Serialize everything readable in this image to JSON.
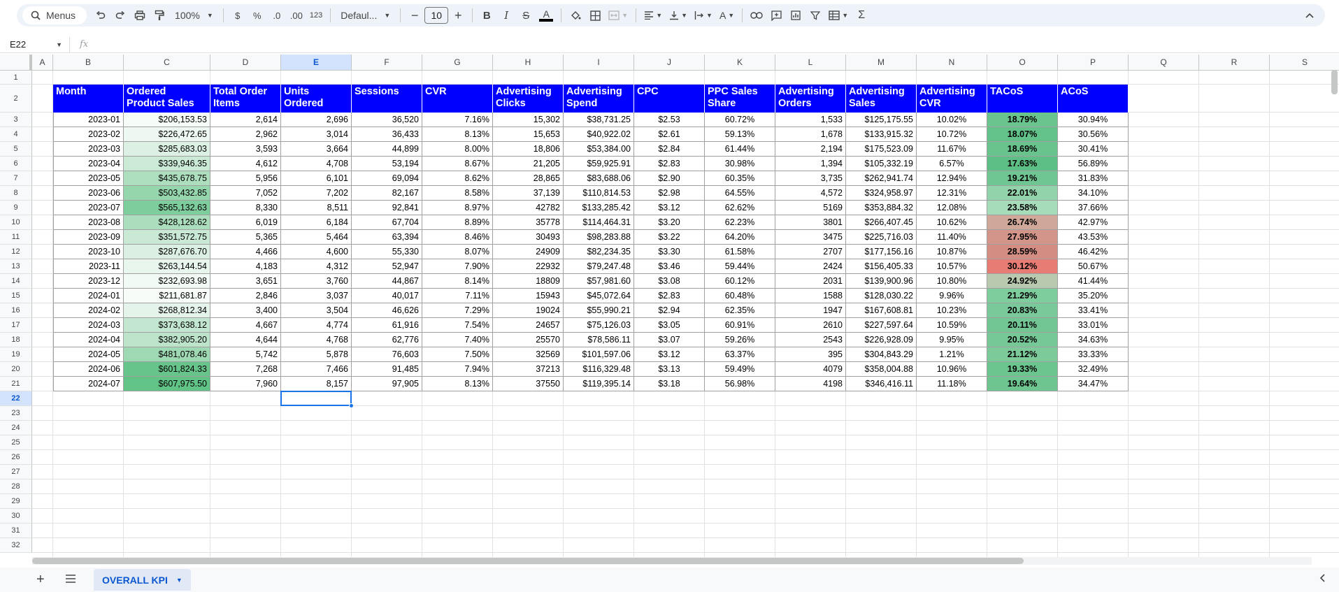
{
  "toolbar": {
    "menus_label": "Menus",
    "zoom": "100%",
    "currency": "$",
    "percent": "%",
    "dec_decrease": ".0",
    "dec_increase": ".00",
    "number_format": "123",
    "font": "Defaul...",
    "font_size": "10"
  },
  "formula_bar": {
    "cell_ref": "E22",
    "fx": "fx",
    "value": ""
  },
  "columns": [
    "A",
    "B",
    "C",
    "D",
    "E",
    "F",
    "G",
    "H",
    "I",
    "J",
    "K",
    "L",
    "M",
    "N",
    "O",
    "P",
    "Q",
    "R",
    "S"
  ],
  "active_column": "E",
  "rows": [
    "1",
    "2",
    "3",
    "4",
    "5",
    "6",
    "7",
    "8",
    "9",
    "10",
    "11",
    "12",
    "13",
    "14",
    "15",
    "16",
    "17",
    "18",
    "19",
    "20",
    "21",
    "22",
    "23",
    "24",
    "25",
    "26",
    "27",
    "28",
    "29",
    "30",
    "31",
    "32"
  ],
  "active_row": "22",
  "table": {
    "headers": [
      "Month",
      "Ordered Product Sales",
      "Total Order Items",
      "Units Ordered",
      "Sessions",
      "CVR",
      "Advertising Clicks",
      "Advertising Spend",
      "CPC",
      "PPC Sales Share",
      "Advertising Orders",
      "Advertising Sales",
      "Advertising CVR",
      "TACoS",
      "ACoS"
    ],
    "rows": [
      [
        "2023-01",
        "$206,153.53",
        "2,614",
        "2,696",
        "36,520",
        "7.16%",
        "15,302",
        "$38,731.25",
        "$2.53",
        "60.72%",
        "1,533",
        "$125,175.55",
        "10.02%",
        "18.79%",
        "30.94%"
      ],
      [
        "2023-02",
        "$226,472.65",
        "2,962",
        "3,014",
        "36,433",
        "8.13%",
        "15,653",
        "$40,922.02",
        "$2.61",
        "59.13%",
        "1,678",
        "$133,915.32",
        "10.72%",
        "18.07%",
        "30.56%"
      ],
      [
        "2023-03",
        "$285,683.03",
        "3,593",
        "3,664",
        "44,899",
        "8.00%",
        "18,806",
        "$53,384.00",
        "$2.84",
        "61.44%",
        "2,194",
        "$175,523.09",
        "11.67%",
        "18.69%",
        "30.41%"
      ],
      [
        "2023-04",
        "$339,946.35",
        "4,612",
        "4,708",
        "53,194",
        "8.67%",
        "21,205",
        "$59,925.91",
        "$2.83",
        "30.98%",
        "1,394",
        "$105,332.19",
        "6.57%",
        "17.63%",
        "56.89%"
      ],
      [
        "2023-05",
        "$435,678.75",
        "5,956",
        "6,101",
        "69,094",
        "8.62%",
        "28,865",
        "$83,688.06",
        "$2.90",
        "60.35%",
        "3,735",
        "$262,941.74",
        "12.94%",
        "19.21%",
        "31.83%"
      ],
      [
        "2023-06",
        "$503,432.85",
        "7,052",
        "7,202",
        "82,167",
        "8.58%",
        "37,139",
        "$110,814.53",
        "$2.98",
        "64.55%",
        "4,572",
        "$324,958.97",
        "12.31%",
        "22.01%",
        "34.10%"
      ],
      [
        "2023-07",
        "$565,132.63",
        "8,330",
        "8,511",
        "92,841",
        "8.97%",
        "42782",
        "$133,285.42",
        "$3.12",
        "62.62%",
        "5169",
        "$353,884.32",
        "12.08%",
        "23.58%",
        "37.66%"
      ],
      [
        "2023-08",
        "$428,128.62",
        "6,019",
        "6,184",
        "67,704",
        "8.89%",
        "35778",
        "$114,464.31",
        "$3.20",
        "62.23%",
        "3801",
        "$266,407.45",
        "10.62%",
        "26.74%",
        "42.97%"
      ],
      [
        "2023-09",
        "$351,572.75",
        "5,365",
        "5,464",
        "63,394",
        "8.46%",
        "30493",
        "$98,283.88",
        "$3.22",
        "64.20%",
        "3475",
        "$225,716.03",
        "11.40%",
        "27.95%",
        "43.53%"
      ],
      [
        "2023-10",
        "$287,676.70",
        "4,466",
        "4,600",
        "55,330",
        "8.07%",
        "24909",
        "$82,234.35",
        "$3.30",
        "61.58%",
        "2707",
        "$177,156.16",
        "10.87%",
        "28.59%",
        "46.42%"
      ],
      [
        "2023-11",
        "$263,144.54",
        "4,183",
        "4,312",
        "52,947",
        "7.90%",
        "22932",
        "$79,247.48",
        "$3.46",
        "59.44%",
        "2424",
        "$156,405.33",
        "10.57%",
        "30.12%",
        "50.67%"
      ],
      [
        "2023-12",
        "$232,693.98",
        "3,651",
        "3,760",
        "44,867",
        "8.14%",
        "18809",
        "$57,981.60",
        "$3.08",
        "60.12%",
        "2031",
        "$139,900.96",
        "10.80%",
        "24.92%",
        "41.44%"
      ],
      [
        "2024-01",
        "$211,681.87",
        "2,846",
        "3,037",
        "40,017",
        "7.11%",
        "15943",
        "$45,072.64",
        "$2.83",
        "60.48%",
        "1588",
        "$128,030.22",
        "9.96%",
        "21.29%",
        "35.20%"
      ],
      [
        "2024-02",
        "$268,812.34",
        "3,400",
        "3,504",
        "46,626",
        "7.29%",
        "19024",
        "$55,990.21",
        "$2.94",
        "62.35%",
        "1947",
        "$167,608.81",
        "10.23%",
        "20.83%",
        "33.41%"
      ],
      [
        "2024-03",
        "$373,638.12",
        "4,667",
        "4,774",
        "61,916",
        "7.54%",
        "24657",
        "$75,126.03",
        "$3.05",
        "60.91%",
        "2610",
        "$227,597.64",
        "10.59%",
        "20.11%",
        "33.01%"
      ],
      [
        "2024-04",
        "$382,905.20",
        "4,644",
        "4,768",
        "62,776",
        "7.40%",
        "25570",
        "$78,586.11",
        "$3.07",
        "59.26%",
        "2543",
        "$226,928.09",
        "9.95%",
        "20.52%",
        "34.63%"
      ],
      [
        "2024-05",
        "$481,078.46",
        "5,742",
        "5,878",
        "76,603",
        "7.50%",
        "32569",
        "$101,597.06",
        "$3.12",
        "63.37%",
        "395",
        "$304,843.29",
        "1.21%",
        "21.12%",
        "33.33%"
      ],
      [
        "2024-06",
        "$601,824.33",
        "7,268",
        "7,466",
        "91,485",
        "7.94%",
        "37213",
        "$116,329.48",
        "$3.13",
        "59.49%",
        "4079",
        "$358,004.88",
        "10.96%",
        "19.33%",
        "32.49%"
      ],
      [
        "2024-07",
        "$607,975.50",
        "7,960",
        "8,157",
        "97,905",
        "8.13%",
        "37550",
        "$119,395.14",
        "$3.18",
        "56.98%",
        "4198",
        "$346,416.11",
        "11.18%",
        "19.64%",
        "34.47%"
      ]
    ],
    "sales_colors": [
      "#f5fbf7",
      "#eef8f2",
      "#dcf1e4",
      "#cbead6",
      "#addfbf",
      "#95d6ad",
      "#7ecd9c",
      "#abdebd",
      "#c9e9d5",
      "#dbf0e3",
      "#e8f6ed",
      "#f2faf5",
      "#f7fcf9",
      "#e5f4ea",
      "#c2e6cf",
      "#bde4cb",
      "#9fd9b4",
      "#67c48a",
      "#62c386"
    ],
    "tacos_colors": [
      "#69c48d",
      "#63c289",
      "#68c48c",
      "#5ebf86",
      "#70c692",
      "#93d3ab",
      "#a7dcbb",
      "#cfa89a",
      "#d3948a",
      "#d38d83",
      "#e67c73",
      "#b9c9af",
      "#7ecd9c",
      "#7ac99a",
      "#72c694",
      "#77c897",
      "#7cca9a",
      "#6bc58e",
      "#6ec590"
    ]
  },
  "sheet_tab": "OVERALL KPI"
}
